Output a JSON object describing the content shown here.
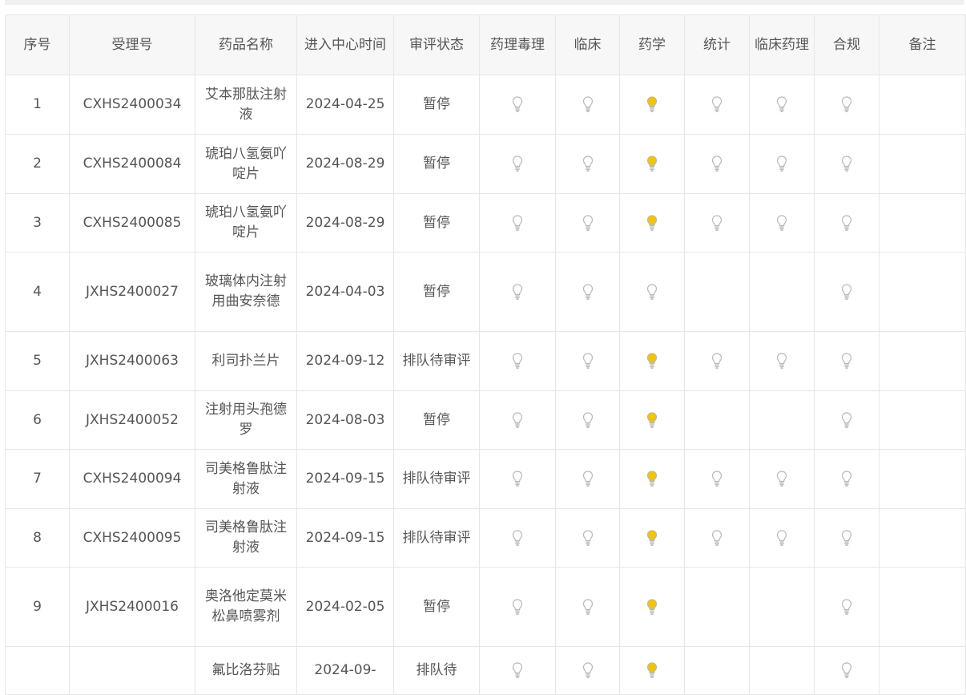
{
  "colors": {
    "bulb_on": "#f2c500",
    "bulb_off": "#ffffff",
    "bulb_outline": "#b8b8b8",
    "header_bg": "#f7f7f7",
    "border": "#e6e6e6"
  },
  "table": {
    "headers": [
      "序号",
      "受理号",
      "药品名称",
      "进入中心时间",
      "审评状态",
      "药理毒理",
      "临床",
      "药学",
      "统计",
      "临床药理",
      "合规",
      "备注"
    ],
    "rows": [
      {
        "no": "1",
        "accept_no": "CXHS2400034",
        "drug": "艾本那肽注射液",
        "date": "2024-04-25",
        "status": "暂停",
        "bulbs": [
          "off",
          "off",
          "on",
          "off",
          "off",
          "off"
        ],
        "note": ""
      },
      {
        "no": "2",
        "accept_no": "CXHS2400084",
        "drug": "琥珀八氢氨吖啶片",
        "date": "2024-08-29",
        "status": "暂停",
        "bulbs": [
          "off",
          "off",
          "on",
          "off",
          "off",
          "off"
        ],
        "note": ""
      },
      {
        "no": "3",
        "accept_no": "CXHS2400085",
        "drug": "琥珀八氢氨吖啶片",
        "date": "2024-08-29",
        "status": "暂停",
        "bulbs": [
          "off",
          "off",
          "on",
          "off",
          "off",
          "off"
        ],
        "note": ""
      },
      {
        "no": "4",
        "accept_no": "JXHS2400027",
        "drug": "玻璃体内注射用曲安奈德",
        "date": "2024-04-03",
        "status": "暂停",
        "bulbs": [
          "off",
          "off",
          "off",
          "",
          "",
          "off"
        ],
        "note": ""
      },
      {
        "no": "5",
        "accept_no": "JXHS2400063",
        "drug": "利司扑兰片",
        "date": "2024-09-12",
        "status": "排队待审评",
        "bulbs": [
          "off",
          "off",
          "on",
          "off",
          "off",
          "off"
        ],
        "note": ""
      },
      {
        "no": "6",
        "accept_no": "JXHS2400052",
        "drug": "注射用头孢德罗",
        "date": "2024-08-03",
        "status": "暂停",
        "bulbs": [
          "off",
          "off",
          "on",
          "",
          "",
          "off"
        ],
        "note": ""
      },
      {
        "no": "7",
        "accept_no": "CXHS2400094",
        "drug": "司美格鲁肽注射液",
        "date": "2024-09-15",
        "status": "排队待审评",
        "bulbs": [
          "off",
          "off",
          "on",
          "off",
          "off",
          "off"
        ],
        "note": ""
      },
      {
        "no": "8",
        "accept_no": "CXHS2400095",
        "drug": "司美格鲁肽注射液",
        "date": "2024-09-15",
        "status": "排队待审评",
        "bulbs": [
          "off",
          "off",
          "on",
          "off",
          "off",
          "off"
        ],
        "note": ""
      },
      {
        "no": "9",
        "accept_no": "JXHS2400016",
        "drug": "奥洛他定莫米松鼻喷雾剂",
        "date": "2024-02-05",
        "status": "暂停",
        "bulbs": [
          "off",
          "off",
          "on",
          "",
          "",
          "off"
        ],
        "note": ""
      },
      {
        "no": "",
        "accept_no": "",
        "drug": "氟比洛芬贴",
        "date": "2024-09-",
        "status": "排队待",
        "bulbs": [
          "off",
          "off",
          "on",
          "",
          "",
          "off"
        ],
        "note": ""
      }
    ]
  }
}
